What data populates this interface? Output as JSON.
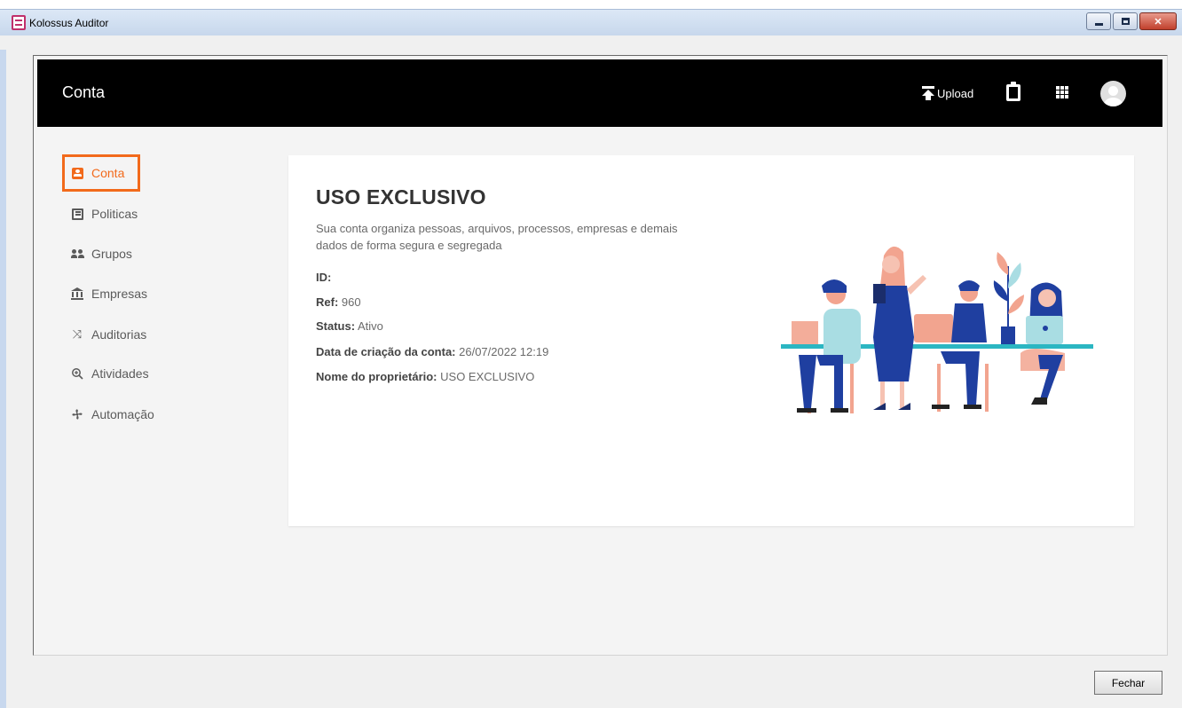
{
  "window": {
    "title": "Kolossus Auditor"
  },
  "header": {
    "title": "Conta",
    "upload_label": "Upload"
  },
  "sidebar": {
    "items": [
      {
        "label": "Conta",
        "icon": "account-box-icon",
        "active": true
      },
      {
        "label": "Politicas",
        "icon": "policy-icon"
      },
      {
        "label": "Grupos",
        "icon": "groups-icon"
      },
      {
        "label": "Empresas",
        "icon": "bank-icon"
      },
      {
        "label": "Auditorias",
        "icon": "shuffle-icon"
      },
      {
        "label": "Atividades",
        "icon": "zoom-icon"
      },
      {
        "label": "Automação",
        "icon": "fan-icon"
      }
    ]
  },
  "account": {
    "title": "USO EXCLUSIVO",
    "description": "Sua conta organiza pessoas, arquivos, processos, empresas e demais dados de forma segura e segregada",
    "fields": [
      {
        "label": "ID:",
        "value": ""
      },
      {
        "label": "Ref:",
        "value": "960"
      },
      {
        "label": "Status:",
        "value": "Ativo"
      },
      {
        "label": "Data de criação da conta:",
        "value": "26/07/2022 12:19"
      },
      {
        "label": "Nome do proprietário:",
        "value": "USO EXCLUSIVO"
      }
    ]
  },
  "footer": {
    "close_label": "Fechar"
  },
  "colors": {
    "accent": "#f26a1b",
    "header_bg": "#000000",
    "illustration_blue": "#1f3fa0",
    "illustration_teal": "#2bb6c2",
    "illustration_pink": "#f2a48f"
  }
}
